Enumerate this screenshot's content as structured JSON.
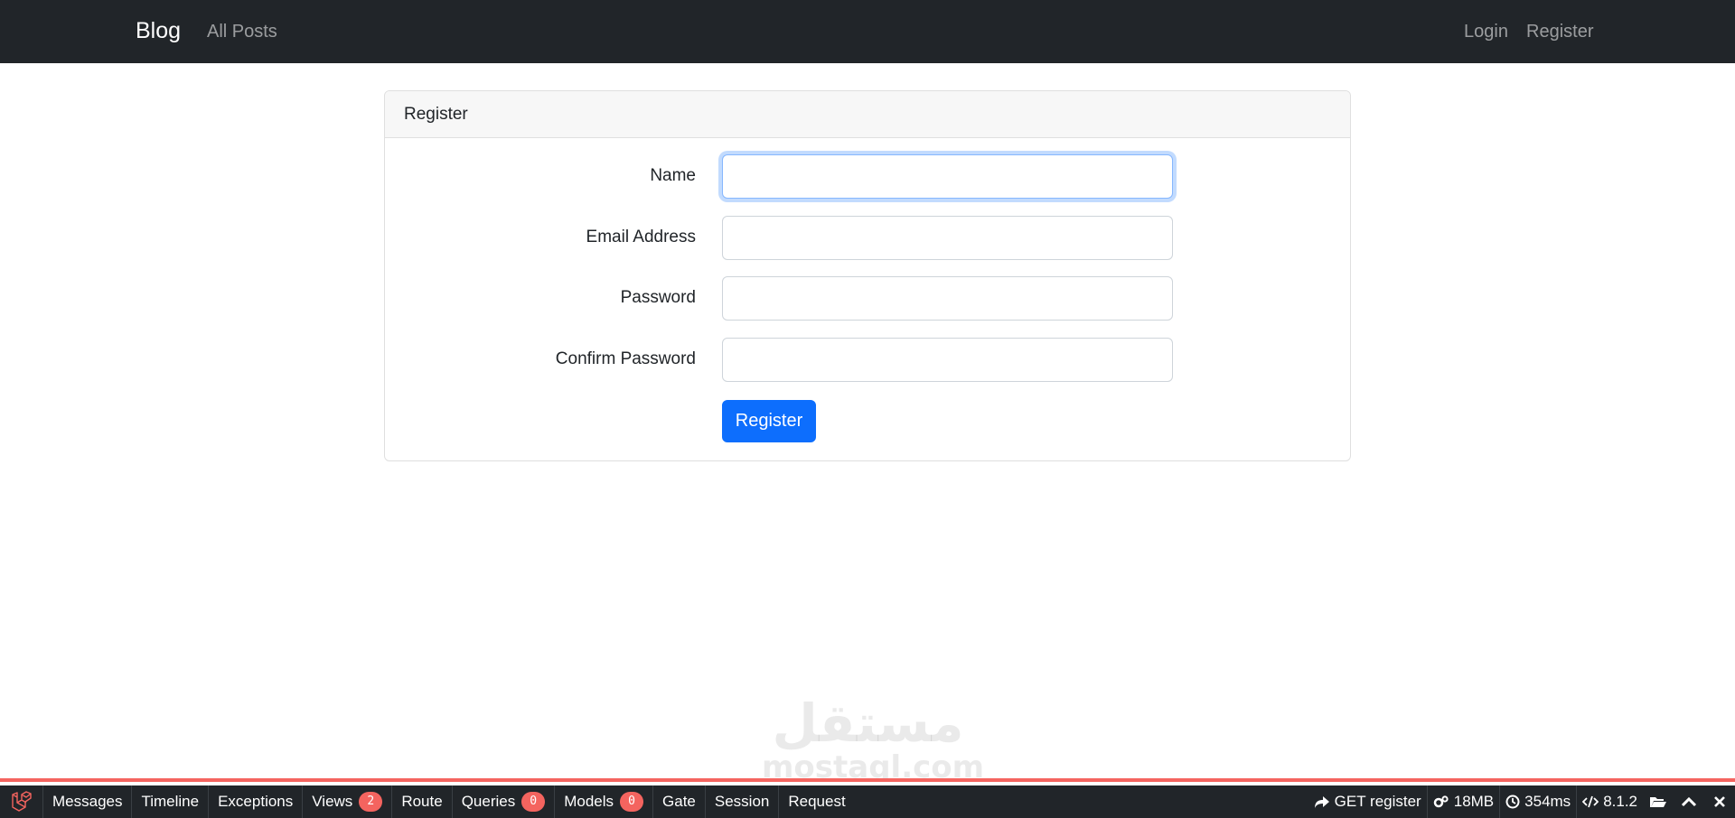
{
  "navbar": {
    "brand": "Blog",
    "links": [
      "All Posts"
    ],
    "right_links": [
      "Login",
      "Register"
    ]
  },
  "card": {
    "header": "Register",
    "fields": [
      {
        "label": "Name",
        "value": "",
        "focused": true
      },
      {
        "label": "Email Address",
        "value": ""
      },
      {
        "label": "Password",
        "value": ""
      },
      {
        "label": "Confirm Password",
        "value": ""
      }
    ],
    "submit_label": "Register"
  },
  "watermark": {
    "arabic": "مستقل",
    "latin": "mostaql.com"
  },
  "debugbar": {
    "tabs": [
      {
        "label": "Messages"
      },
      {
        "label": "Timeline"
      },
      {
        "label": "Exceptions"
      },
      {
        "label": "Views",
        "badge": "2"
      },
      {
        "label": "Route"
      },
      {
        "label": "Queries",
        "badge": "0"
      },
      {
        "label": "Models",
        "badge": "0"
      },
      {
        "label": "Gate"
      },
      {
        "label": "Session"
      },
      {
        "label": "Request"
      }
    ],
    "request": "GET register",
    "memory": "18MB",
    "time": "354ms",
    "php_version": "8.1.2",
    "accent_color": "#f4645f"
  }
}
